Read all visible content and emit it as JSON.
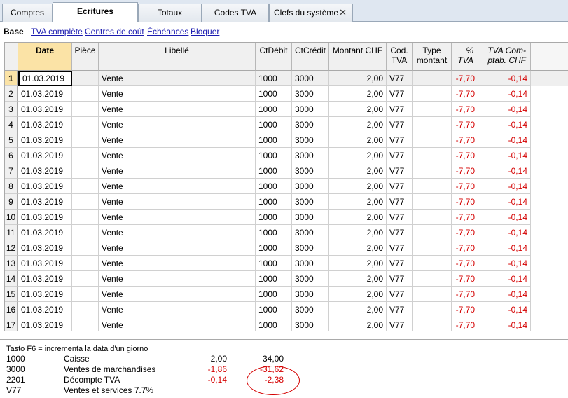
{
  "tabs": [
    {
      "label": "Comptes",
      "active": false
    },
    {
      "label": "Ecritures",
      "active": true
    },
    {
      "label": "Totaux",
      "active": false
    },
    {
      "label": "Codes TVA",
      "active": false
    },
    {
      "label": "Clefs du système",
      "active": false,
      "closable": true
    }
  ],
  "views": [
    {
      "label": "Base",
      "active": true
    },
    {
      "label": "TVA complète",
      "active": false
    },
    {
      "label": "Centres de coût",
      "active": false
    },
    {
      "label": "Échéances",
      "active": false
    },
    {
      "label": "Bloquer",
      "active": false
    }
  ],
  "columns": {
    "date": "Date",
    "piece": "Pièce",
    "libelle": "Libellé",
    "ctdebit": "CtDébit",
    "ctcredit": "CtCrédit",
    "montant": "Montant CHF",
    "codtva": "Cod. TVA",
    "type": "Type montant",
    "pcttva": "% TVA",
    "tvacomptab": "TVA Com- ptab. CHF"
  },
  "rows": [
    {
      "n": "1",
      "date": "01.03.2019",
      "piece": "",
      "libelle": "Vente",
      "ctdebit": "1000",
      "ctcredit": "3000",
      "montant": "2,00",
      "codtva": "V77",
      "type": "",
      "pcttva": "-7,70",
      "tvacomptab": "-0,14"
    },
    {
      "n": "2",
      "date": "01.03.2019",
      "piece": "",
      "libelle": "Vente",
      "ctdebit": "1000",
      "ctcredit": "3000",
      "montant": "2,00",
      "codtva": "V77",
      "type": "",
      "pcttva": "-7,70",
      "tvacomptab": "-0,14"
    },
    {
      "n": "3",
      "date": "01.03.2019",
      "piece": "",
      "libelle": "Vente",
      "ctdebit": "1000",
      "ctcredit": "3000",
      "montant": "2,00",
      "codtva": "V77",
      "type": "",
      "pcttva": "-7,70",
      "tvacomptab": "-0,14"
    },
    {
      "n": "4",
      "date": "01.03.2019",
      "piece": "",
      "libelle": "Vente",
      "ctdebit": "1000",
      "ctcredit": "3000",
      "montant": "2,00",
      "codtva": "V77",
      "type": "",
      "pcttva": "-7,70",
      "tvacomptab": "-0,14"
    },
    {
      "n": "5",
      "date": "01.03.2019",
      "piece": "",
      "libelle": "Vente",
      "ctdebit": "1000",
      "ctcredit": "3000",
      "montant": "2,00",
      "codtva": "V77",
      "type": "",
      "pcttva": "-7,70",
      "tvacomptab": "-0,14"
    },
    {
      "n": "6",
      "date": "01.03.2019",
      "piece": "",
      "libelle": "Vente",
      "ctdebit": "1000",
      "ctcredit": "3000",
      "montant": "2,00",
      "codtva": "V77",
      "type": "",
      "pcttva": "-7,70",
      "tvacomptab": "-0,14"
    },
    {
      "n": "7",
      "date": "01.03.2019",
      "piece": "",
      "libelle": "Vente",
      "ctdebit": "1000",
      "ctcredit": "3000",
      "montant": "2,00",
      "codtva": "V77",
      "type": "",
      "pcttva": "-7,70",
      "tvacomptab": "-0,14"
    },
    {
      "n": "8",
      "date": "01.03.2019",
      "piece": "",
      "libelle": "Vente",
      "ctdebit": "1000",
      "ctcredit": "3000",
      "montant": "2,00",
      "codtva": "V77",
      "type": "",
      "pcttva": "-7,70",
      "tvacomptab": "-0,14"
    },
    {
      "n": "9",
      "date": "01.03.2019",
      "piece": "",
      "libelle": "Vente",
      "ctdebit": "1000",
      "ctcredit": "3000",
      "montant": "2,00",
      "codtva": "V77",
      "type": "",
      "pcttva": "-7,70",
      "tvacomptab": "-0,14"
    },
    {
      "n": "10",
      "date": "01.03.2019",
      "piece": "",
      "libelle": "Vente",
      "ctdebit": "1000",
      "ctcredit": "3000",
      "montant": "2,00",
      "codtva": "V77",
      "type": "",
      "pcttva": "-7,70",
      "tvacomptab": "-0,14"
    },
    {
      "n": "11",
      "date": "01.03.2019",
      "piece": "",
      "libelle": "Vente",
      "ctdebit": "1000",
      "ctcredit": "3000",
      "montant": "2,00",
      "codtva": "V77",
      "type": "",
      "pcttva": "-7,70",
      "tvacomptab": "-0,14"
    },
    {
      "n": "12",
      "date": "01.03.2019",
      "piece": "",
      "libelle": "Vente",
      "ctdebit": "1000",
      "ctcredit": "3000",
      "montant": "2,00",
      "codtva": "V77",
      "type": "",
      "pcttva": "-7,70",
      "tvacomptab": "-0,14"
    },
    {
      "n": "13",
      "date": "01.03.2019",
      "piece": "",
      "libelle": "Vente",
      "ctdebit": "1000",
      "ctcredit": "3000",
      "montant": "2,00",
      "codtva": "V77",
      "type": "",
      "pcttva": "-7,70",
      "tvacomptab": "-0,14"
    },
    {
      "n": "14",
      "date": "01.03.2019",
      "piece": "",
      "libelle": "Vente",
      "ctdebit": "1000",
      "ctcredit": "3000",
      "montant": "2,00",
      "codtva": "V77",
      "type": "",
      "pcttva": "-7,70",
      "tvacomptab": "-0,14"
    },
    {
      "n": "15",
      "date": "01.03.2019",
      "piece": "",
      "libelle": "Vente",
      "ctdebit": "1000",
      "ctcredit": "3000",
      "montant": "2,00",
      "codtva": "V77",
      "type": "",
      "pcttva": "-7,70",
      "tvacomptab": "-0,14"
    },
    {
      "n": "16",
      "date": "01.03.2019",
      "piece": "",
      "libelle": "Vente",
      "ctdebit": "1000",
      "ctcredit": "3000",
      "montant": "2,00",
      "codtva": "V77",
      "type": "",
      "pcttva": "-7,70",
      "tvacomptab": "-0,14"
    },
    {
      "n": "17",
      "date": "01.03.2019",
      "piece": "",
      "libelle": "Vente",
      "ctdebit": "1000",
      "ctcredit": "3000",
      "montant": "2,00",
      "codtva": "V77",
      "type": "",
      "pcttva": "-7,70",
      "tvacomptab": "-0,14"
    }
  ],
  "info": {
    "hint": "Tasto F6 = incrementa la data d'un giorno",
    "lines": [
      {
        "code": "1000",
        "desc": "Caisse",
        "v1": "2,00",
        "v2": "34,00",
        "red": false
      },
      {
        "code": "3000",
        "desc": "Ventes de marchandises",
        "v1": "-1,86",
        "v2": "-31,62",
        "red": true
      },
      {
        "code": "2201",
        "desc": "Décompte TVA",
        "v1": "-0,14",
        "v2": "-2,38",
        "red": true
      },
      {
        "code": "V77",
        "desc": "Ventes et services 7.7%",
        "v1": "",
        "v2": "",
        "red": false
      }
    ]
  },
  "colors": {
    "accent_header": "#fbe3a6",
    "negative": "#d40000",
    "link": "#1a1ab0"
  }
}
